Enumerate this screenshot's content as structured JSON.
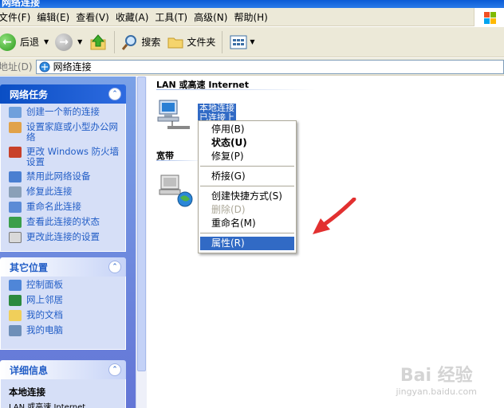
{
  "window": {
    "title": "网络连接"
  },
  "menu": [
    "文件(F)",
    "编辑(E)",
    "查看(V)",
    "收藏(A)",
    "工具(T)",
    "高级(N)",
    "帮助(H)"
  ],
  "toolbar": {
    "back": "后退",
    "search": "搜索",
    "folders": "文件夹"
  },
  "address": {
    "label": "地址(D)",
    "value": "网络连接"
  },
  "network_tasks": {
    "title": "网络任务",
    "items": [
      "创建一个新的连接",
      "设置家庭或小型办公网络",
      "更改 Windows 防火墙设置",
      "禁用此网络设备",
      "修复此连接",
      "重命名此连接",
      "查看此连接的状态",
      "更改此连接的设置"
    ]
  },
  "other_places": {
    "title": "其它位置",
    "items": [
      "控制面板",
      "网上邻居",
      "我的文档",
      "我的电脑"
    ]
  },
  "details": {
    "title": "详细信息",
    "name": "本地连接",
    "type": "LAN 或高速 Internet"
  },
  "groups": {
    "lan": "LAN 或高速 Internet",
    "broadband": "宽带"
  },
  "connection": {
    "name": "本地连接",
    "status": "已连接上"
  },
  "context_menu": {
    "disable": "停用(B)",
    "status": "状态(U)",
    "repair": "修复(P)",
    "bridge": "桥接(G)",
    "shortcut": "创建快捷方式(S)",
    "delete": "删除(D)",
    "rename": "重命名(M)",
    "properties": "属性(R)"
  },
  "watermark": {
    "brand": "Bai 经验",
    "url": "jingyan.baidu.com"
  },
  "colors": {
    "selection": "#316ac5",
    "task_link": "#215dc6",
    "arrow": "#e23030"
  }
}
